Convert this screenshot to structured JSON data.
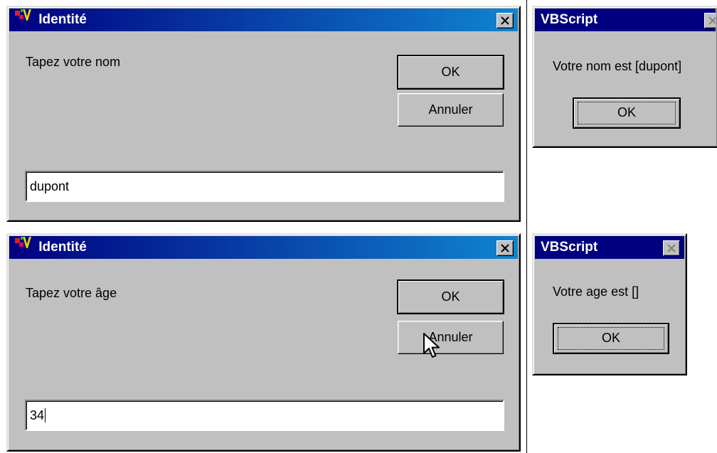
{
  "dialog_name": {
    "title": "Identité",
    "prompt": "Tapez votre nom",
    "ok_label": "OK",
    "cancel_label": "Annuler",
    "input_value": "dupont"
  },
  "msgbox_name": {
    "title": "VBScript",
    "message": "Votre nom est [dupont]",
    "ok_label": "OK"
  },
  "dialog_age": {
    "title": "Identité",
    "prompt": "Tapez votre âge",
    "ok_label": "OK",
    "cancel_label": "Annuler",
    "input_value": "34"
  },
  "msgbox_age": {
    "title": "VBScript",
    "message": "Votre age est []",
    "ok_label": "OK"
  },
  "icons": {
    "app": "vbscript-app-icon",
    "close": "close-icon",
    "pointer": "mouse-pointer-icon"
  }
}
